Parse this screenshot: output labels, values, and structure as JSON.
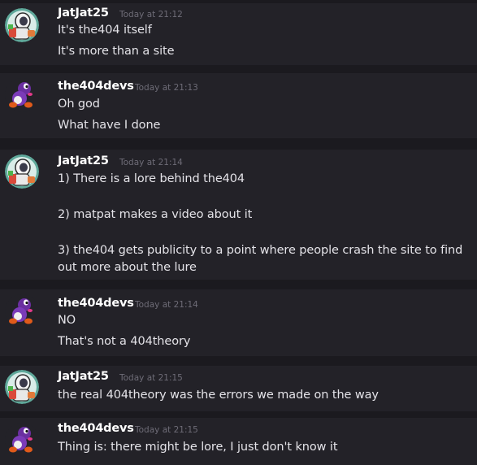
{
  "messages": [
    {
      "author": "JatJat25",
      "timestamp": "Today at 21:12",
      "avatar_icon": "astronaut-avatar-icon",
      "lines": [
        "It's the404 itself",
        "It's more than a site"
      ]
    },
    {
      "author": "the404devs",
      "timestamp": "Today at 21:13",
      "avatar_icon": "purple-yoshi-avatar-icon",
      "lines": [
        "Oh god",
        "What have I done"
      ]
    },
    {
      "author": "JatJat25",
      "timestamp": "Today at 21:14",
      "avatar_icon": "astronaut-avatar-icon",
      "lines": [
        "1) There is a lore behind the404",
        "",
        "2) matpat makes a video about it",
        "",
        "3) the404 gets publicity to a point where people crash the site to find",
        "out more about the lure"
      ]
    },
    {
      "author": "the404devs",
      "timestamp": "Today at 21:14",
      "avatar_icon": "purple-yoshi-avatar-icon",
      "lines": [
        "NO",
        "That's not a 404theory"
      ]
    },
    {
      "author": "JatJat25",
      "timestamp": "Today at 21:15",
      "avatar_icon": "astronaut-avatar-icon",
      "lines": [
        "the real 404theory was the errors we made on the way"
      ]
    },
    {
      "author": "the404devs",
      "timestamp": "Today at 21:15",
      "avatar_icon": "purple-yoshi-avatar-icon",
      "lines": [
        "Thing is: there might be lore, I just don't know it"
      ]
    }
  ]
}
